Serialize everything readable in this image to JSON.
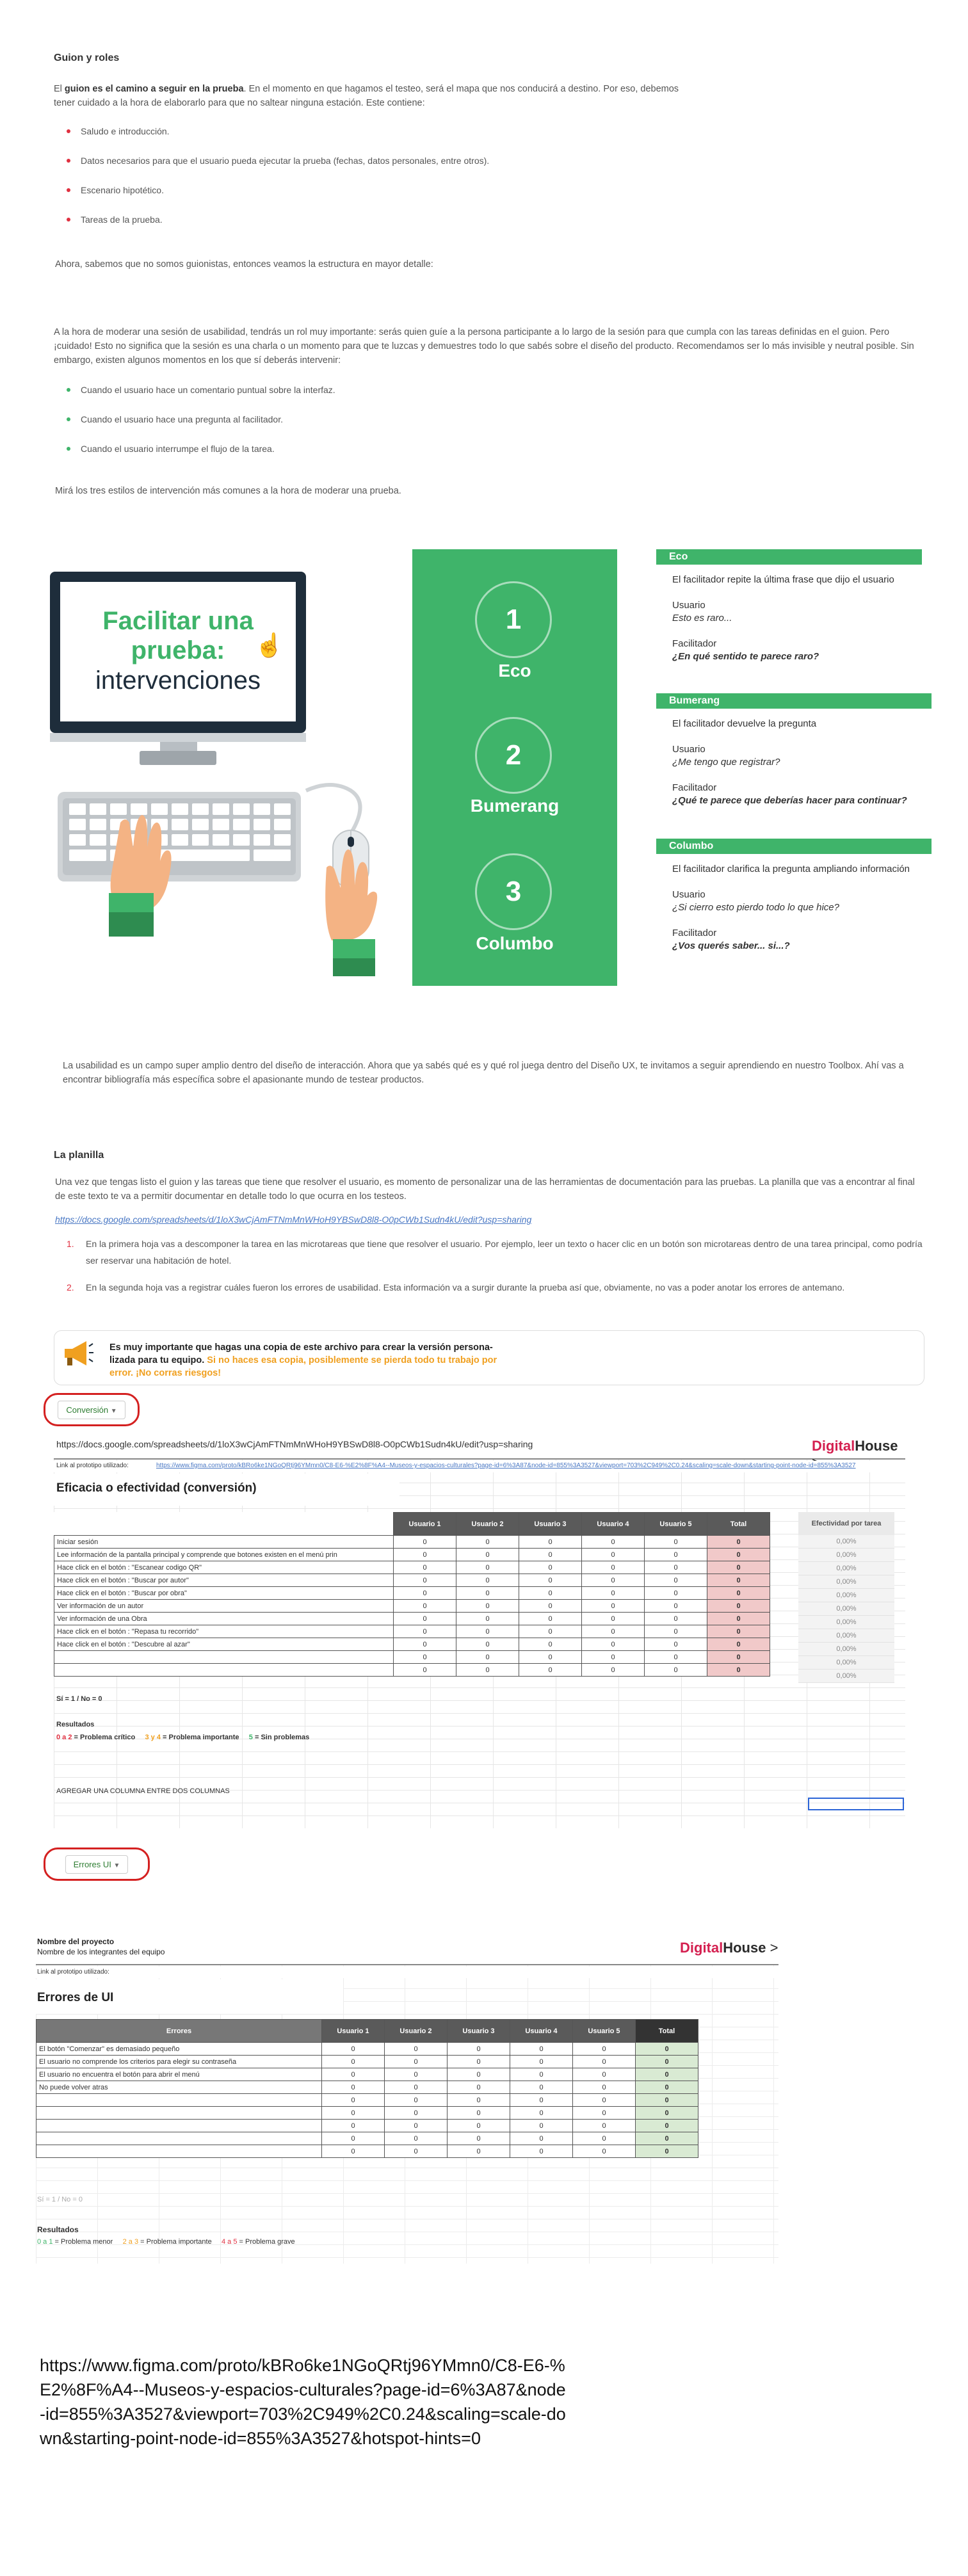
{
  "section1": {
    "title": "Guion y roles",
    "intro_pre": "El ",
    "intro_bold": "guion es el camino a seguir en la prueba",
    "intro_post": ". En el momento en que hagamos el testeo, será el mapa que nos conducirá a destino. Por eso, debemos tener cuidado a la hora de elaborarlo para que no saltear ninguna estación. Este contiene:",
    "bullets": [
      "Saludo e introducción.",
      "Datos necesarios para que el usuario pueda ejecutar la prueba (fechas, datos personales, entre otros).",
      "Escenario hipotético.",
      "Tareas de la prueba."
    ],
    "outro": "Ahora, sabemos que no somos guionistas, entonces veamos la estructura en mayor detalle:"
  },
  "section2": {
    "para": "A la hora de moderar una sesión de usabilidad, tendrás un rol muy importante: serás quien guíe a la persona participante a lo largo de la sesión para que cumpla con las tareas definidas en el guion. Pero ¡cuidado! Esto no significa que la sesión es una charla o un momento para que te luzcas y demuestres todo lo que sabés sobre el diseño del producto. Recomendamos ser lo más invisible y neutral posible. Sin embargo, existen algunos momentos en los que sí deberás intervenir:",
    "bullets": [
      "Cuando el usuario hace un comentario puntual sobre la interfaz.",
      "Cuando el usuario hace una pregunta al facilitador.",
      "Cuando el usuario interrumpe el flujo de la tarea."
    ],
    "outro": "Mirá los tres estilos de intervención más comunes a la hora de moderar una prueba."
  },
  "infographic": {
    "title_line1": "Facilitar una",
    "title_line2": "prueba:",
    "title_line3": "intervenciones",
    "steps": [
      {
        "num": "1",
        "label": "Eco"
      },
      {
        "num": "2",
        "label": "Bumerang"
      },
      {
        "num": "3",
        "label": "Columbo"
      }
    ],
    "cards": [
      {
        "head": "Eco",
        "desc": "El facilitador repite la última frase que dijo el usuario",
        "user_label": "Usuario",
        "user_text": "Esto es raro...",
        "fac_label": "Facilitador",
        "fac_text": "¿En qué sentido te parece raro?"
      },
      {
        "head": "Bumerang",
        "desc": "El facilitador devuelve la pregunta",
        "user_label": "Usuario",
        "user_text": "¿Me tengo que registrar?",
        "fac_label": "Facilitador",
        "fac_text": "¿Qué te parece que deberías hacer para continuar?"
      },
      {
        "head": "Columbo",
        "desc": "El facilitador clarifica la pregunta ampliando información",
        "user_label": "Usuario",
        "user_text": "¿Si cierro esto pierdo todo lo que hice?",
        "fac_label": "Facilitador",
        "fac_text": "¿Vos querés saber... si...?"
      }
    ]
  },
  "closing": "La usabilidad es un campo super amplio dentro del diseño de interacción. Ahora que ya sabés qué es y qué rol juega dentro del Diseño UX, te invitamos a seguir aprendiendo en nuestro Toolbox. Ahí vas a encontrar bibliografía más específica sobre el apasionante mundo de testear productos.",
  "planilla": {
    "title": "La planilla",
    "para": "Una vez que tengas listo el guion y las tareas que tiene que resolver el usuario, es momento de personalizar una de las herramientas de documentación para las pruebas. La planilla que vas a encontrar al final de este texto te va a permitir documentar en detalle todo lo que ocurra en los testeos.",
    "link": "https://docs.google.com/spreadsheets/d/1loX3wCjAmFTNmMnWHoH9YBSwD8l8-O0pCWb1Sudn4kU/edit?usp=sharing",
    "steps": [
      {
        "n": "1.",
        "text": "En la primera hoja vas a descomponer la tarea en las microtareas que tiene que resolver el usuario. Por ejemplo, leer un texto o hacer clic en un botón son microtareas dentro de una tarea principal, como podría ser reservar una habitación de hotel."
      },
      {
        "n": "2.",
        "text": "En la segunda hoja vas a registrar cuáles fueron los errores de usabilidad. Esta información va a surgir durante la prueba así que, obviamente, no vas a poder anotar los errores de antemano."
      }
    ],
    "notice_line1": "Es muy importante que hagas una copia de este archivo para crear la versión persona-",
    "notice_line2": "lizada para tu equipo.",
    "notice_orange1": " Si no haces esa copia, posiblemente se pierda todo tu trabajo por",
    "notice_orange2": "error. ¡No corras riesgos!"
  },
  "sheet1": {
    "tab": "Conversión",
    "url": "https://docs.google.com/spreadsheets/d/1loX3wCjAmFTNmMnWHoH9YBSwD8l8-O0pCWb1Sudn4kU/edit?usp=sharing",
    "brand_a": "Digital",
    "brand_b": "House",
    "proto_label": "Link al prototipo utilizado:",
    "proto_url": "https://www.figma.com/proto/kBRo6ke1NGoQRtj96YMmn0/C8-E6-%E2%8F%A4--Museos-y-espacios-culturales?page-id=6%3A87&node-id=855%3A3527&viewport=703%2C949%2C0.24&scaling=scale-down&starting-point-node-id=855%3A3527",
    "title": "Eficacia o efectividad (conversión)",
    "headers": [
      "Usuario 1",
      "Usuario 2",
      "Usuario 3",
      "Usuario 4",
      "Usuario 5",
      "Total"
    ],
    "eff_header": "Efectividad por tarea",
    "rows": [
      "Iniciar sesión",
      "Lee información de la pantalla principal y comprende que botones existen en el menú prin",
      "Hace click en el botón : \"Escanear codigo QR\"",
      "Hace click en el botón : \"Buscar por autor\"",
      "Hace click en el botón : \"Buscar por obra\"",
      "Ver información de un autor",
      "Ver información de una Obra",
      "Hace click en el botón : \"Repasa tu recorrido\"",
      "Hace click en el botón : \"Descubre al azar\"",
      "",
      ""
    ],
    "zero": "0",
    "pct": "0,00%",
    "legend": "Sí = 1 / No = 0",
    "results": "Resultados",
    "r1a": "0 a 2",
    "r1b": " = Problema crítico",
    "r2a": "3 y 4",
    "r2b": " = Problema importante",
    "r3a": "5",
    "r3b": " = Sin problemas",
    "add_col": "AGREGAR UNA COLUMNA ENTRE DOS COLUMNAS"
  },
  "sheet2": {
    "tab": "Errores UI",
    "project_label": "Nombre del proyecto",
    "team_label": "Nombre de los integrantes del equipo",
    "brand_a": "Digital",
    "brand_b": "House",
    "proto_label": "Link al prototipo utilizado:",
    "title": "Errores de UI",
    "headers": [
      "Errores",
      "Usuario 1",
      "Usuario 2",
      "Usuario 3",
      "Usuario 4",
      "Usuario 5",
      "Total"
    ],
    "rows": [
      "El botón \"Comenzar\" es demasiado pequeño",
      "El usuario no comprende los criterios para elegir su contraseña",
      "El usuario no encuentra el botón para abrir el menú",
      "No puede volver atras",
      "",
      "",
      "",
      "",
      ""
    ],
    "zero": "0",
    "legend": "Sí = 1 / No = 0",
    "results": "Resultados",
    "r1a": "0 a 1",
    "r1b": " = Problema menor",
    "r2a": "2 a 3",
    "r2b": " = Problema importante",
    "r3a": "4 a 5",
    "r3b": " = Problema grave"
  },
  "footer_url": "https://www.figma.com/proto/kBRo6ke1NGoQRtj96YMmn0/C8-E6-%E2%8F%A4--Museos-y-espacios-culturales?page-id=6%3A87&node-id=855%3A3527&viewport=703%2C949%2C0.24&scaling=scale-down&starting-point-node-id=855%3A3527&hotspot-hints=0",
  "colors": {
    "green": "#3fb46a",
    "red": "#e03040",
    "orange": "#f0a020",
    "monitor": "#1e2d3b"
  }
}
